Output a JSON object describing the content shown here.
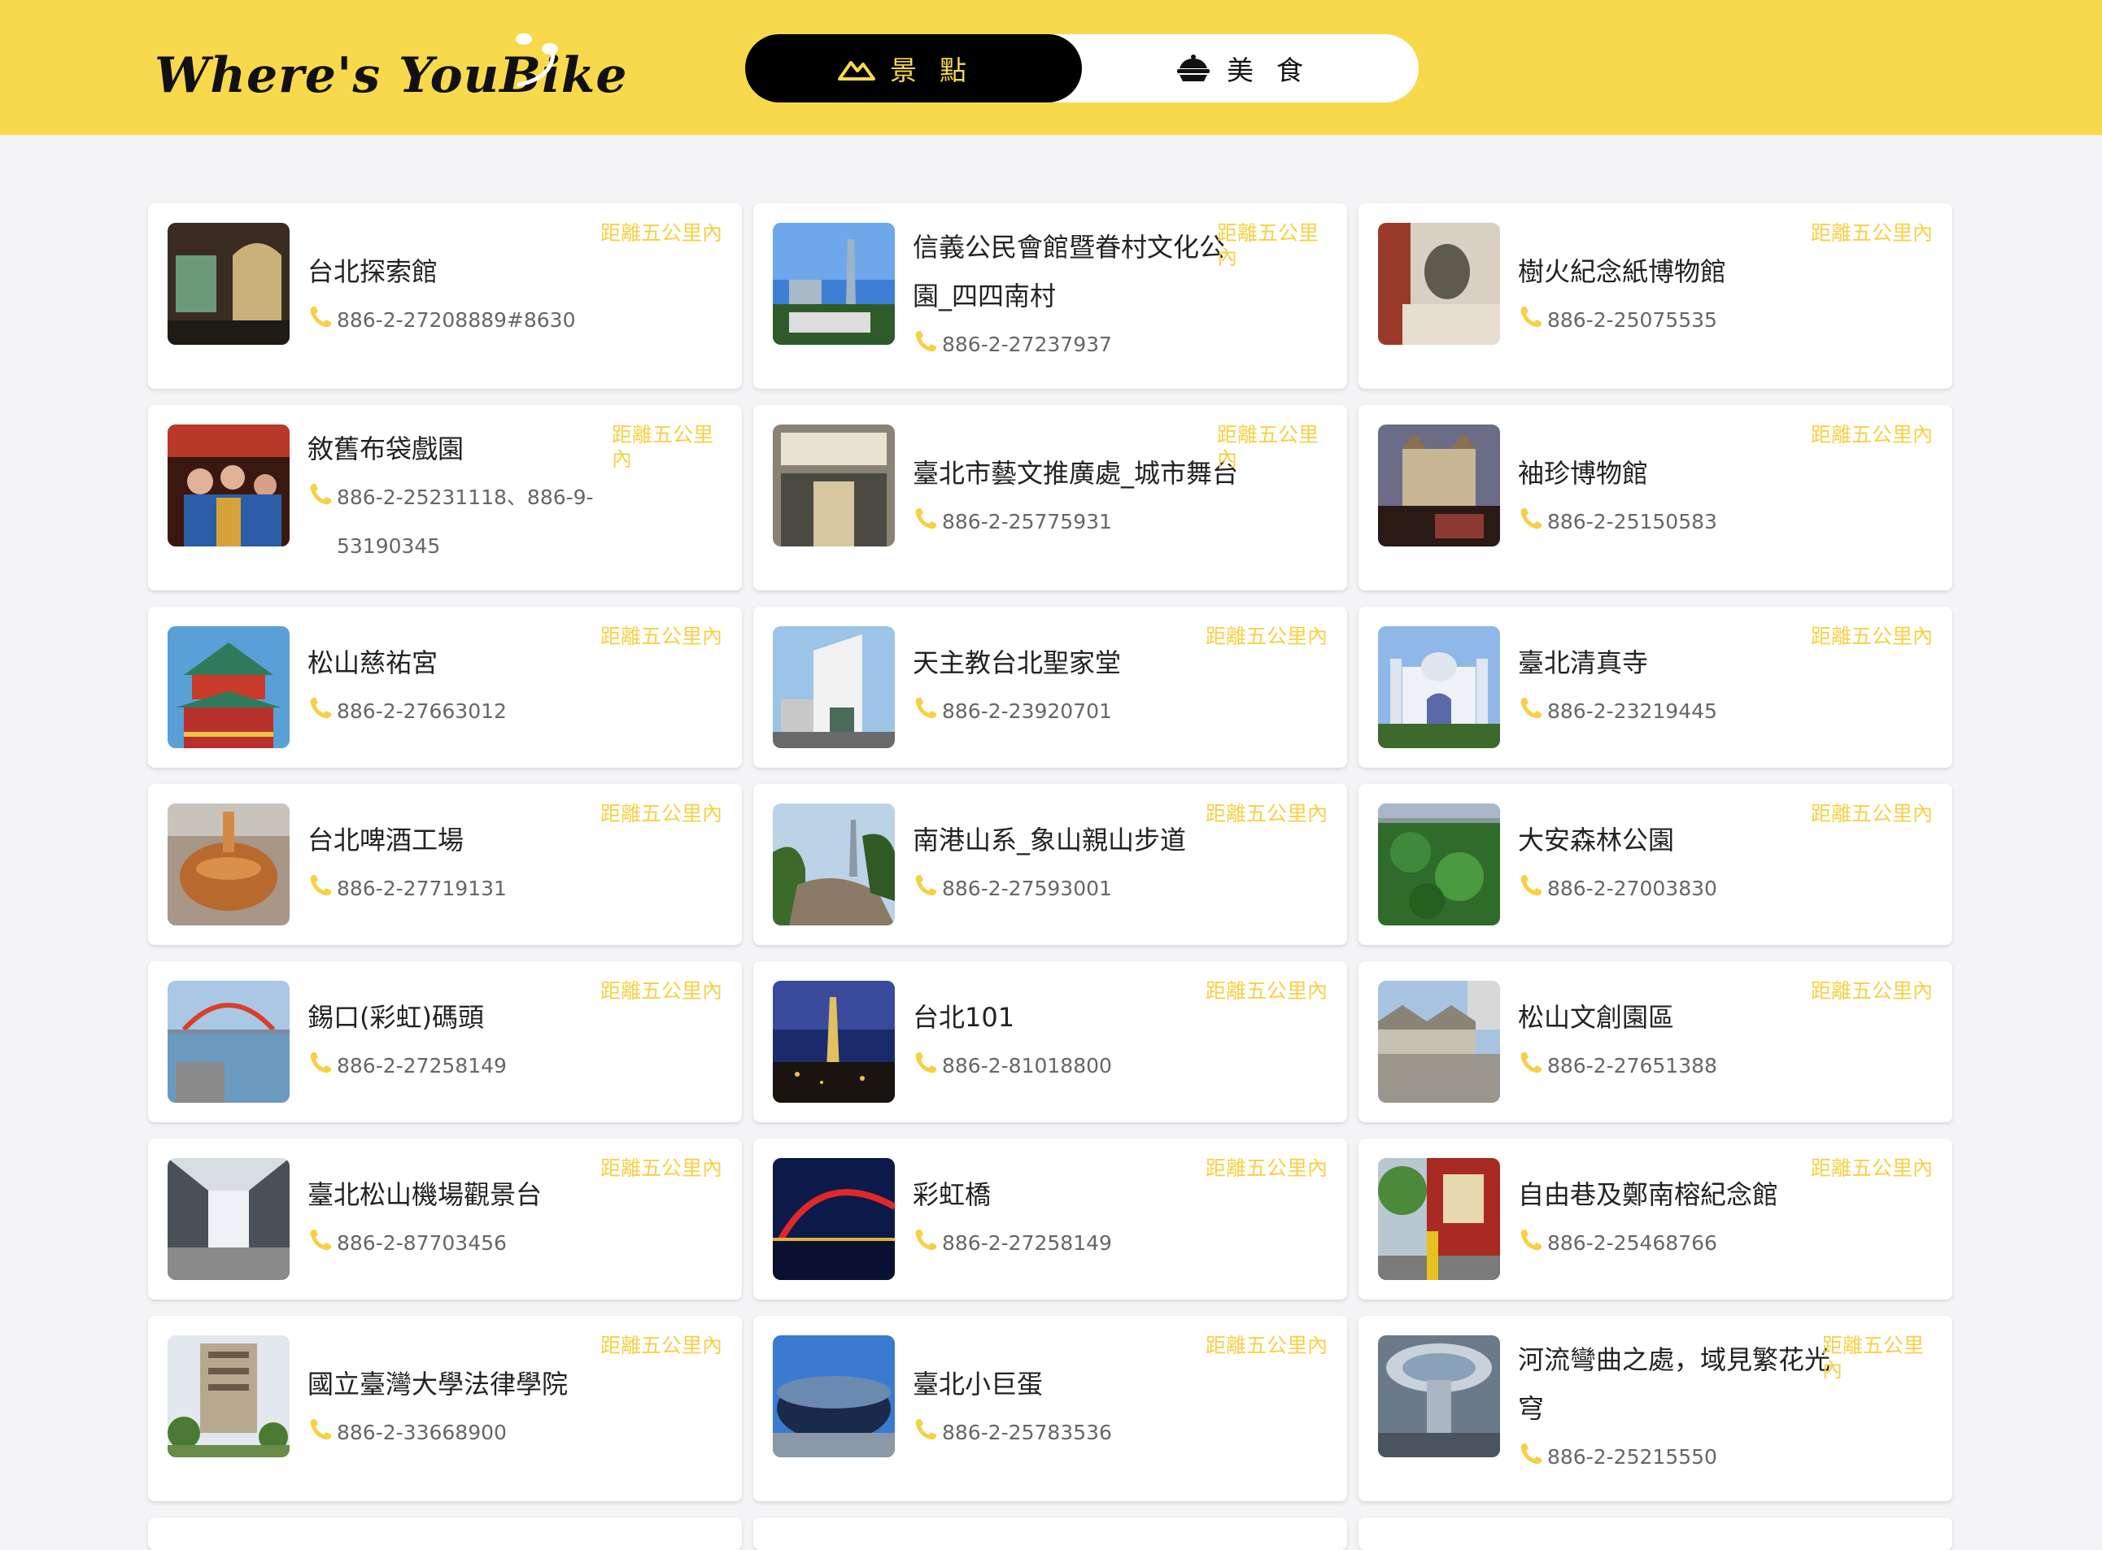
{
  "app": {
    "logo_text": "Where's YouBike",
    "accent_color": "#f9d94c"
  },
  "tabs": [
    {
      "label": "景點",
      "icon": "mountain-icon",
      "active": true
    },
    {
      "label": "美食",
      "icon": "dumpling-icon",
      "active": false
    }
  ],
  "distance_label": "距離五公里內",
  "cards": [
    {
      "name": "台北探索館",
      "phone": "886-2-27208889#8630",
      "image": "museum-interior"
    },
    {
      "name": "信義公民會館暨眷村文化公園_四四南村",
      "phone": "886-2-27237937",
      "image": "taipei101-village"
    },
    {
      "name": "樹火紀念紙博物館",
      "phone": "886-2-25075535",
      "image": "paper-stone"
    },
    {
      "name": "敘舊布袋戲園",
      "phone": "886-2-25231118、886-9-53190345",
      "image": "puppet-theater"
    },
    {
      "name": "臺北市藝文推廣處_城市舞台",
      "phone": "886-2-25775931",
      "image": "city-stage"
    },
    {
      "name": "袖珍博物館",
      "phone": "886-2-25150583",
      "image": "miniature-castle"
    },
    {
      "name": "松山慈祐宮",
      "phone": "886-2-27663012",
      "image": "temple"
    },
    {
      "name": "天主教台北聖家堂",
      "phone": "886-2-23920701",
      "image": "church"
    },
    {
      "name": "臺北清真寺",
      "phone": "886-2-23219445",
      "image": "mosque"
    },
    {
      "name": "台北啤酒工場",
      "phone": "886-2-27719131",
      "image": "brewery"
    },
    {
      "name": "南港山系_象山親山步道",
      "phone": "886-2-27593001",
      "image": "elephant-mountain"
    },
    {
      "name": "大安森林公園",
      "phone": "886-2-27003830",
      "image": "forest-park"
    },
    {
      "name": "錫口(彩虹)碼頭",
      "phone": "886-2-27258149",
      "image": "wharf"
    },
    {
      "name": "台北101",
      "phone": "886-2-81018800",
      "image": "taipei101-night"
    },
    {
      "name": "松山文創園區",
      "phone": "886-2-27651388",
      "image": "creative-park"
    },
    {
      "name": "臺北松山機場觀景台",
      "phone": "886-2-87703456",
      "image": "airport-deck"
    },
    {
      "name": "彩虹橋",
      "phone": "886-2-27258149",
      "image": "rainbow-bridge"
    },
    {
      "name": "自由巷及鄭南榕紀念館",
      "phone": "886-2-25468766",
      "image": "memorial-lane"
    },
    {
      "name": "國立臺灣大學法律學院",
      "phone": "886-2-33668900",
      "image": "law-college"
    },
    {
      "name": "臺北小巨蛋",
      "phone": "886-2-25783536",
      "image": "arena"
    },
    {
      "name": "河流彎曲之處，域見繁花光穹",
      "phone": "886-2-25215550",
      "image": "light-dome"
    }
  ]
}
